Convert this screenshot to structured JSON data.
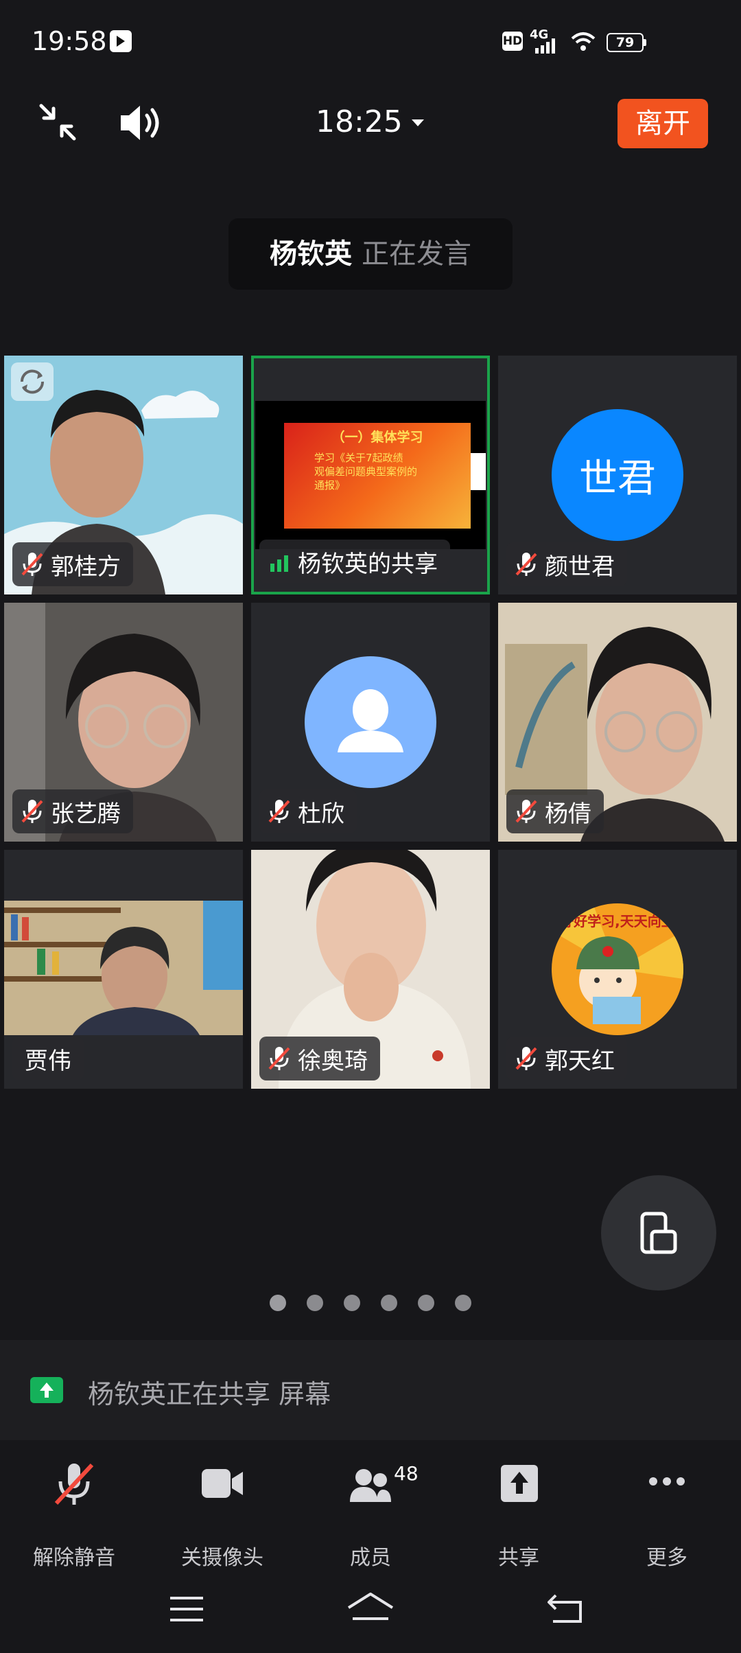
{
  "status_bar": {
    "time": "19:58",
    "hd": "HD",
    "network": "4G",
    "battery": "79"
  },
  "top_bar": {
    "meeting_time": "18:25",
    "leave_label": "离开"
  },
  "speaking_banner": {
    "name": "杨钦英",
    "text": "正在发言"
  },
  "tiles": [
    {
      "name": "郭桂方",
      "kind": "video",
      "muted": true
    },
    {
      "name": "杨钦英的共享",
      "kind": "screen-share",
      "muted": false,
      "active_speaker": true
    },
    {
      "name": "颜世君",
      "kind": "avatar",
      "avatar_text": "世君",
      "avatar_color": "#0a87ff",
      "muted": true
    },
    {
      "name": "张艺腾",
      "kind": "video",
      "muted": true
    },
    {
      "name": "杜欣",
      "kind": "avatar-default",
      "avatar_color": "#7fb5ff",
      "muted": true
    },
    {
      "name": "杨倩",
      "kind": "video",
      "muted": true
    },
    {
      "name": "贾伟",
      "kind": "video",
      "muted": false
    },
    {
      "name": "徐奥琦",
      "kind": "video",
      "muted": true
    },
    {
      "name": "郭天红",
      "kind": "avatar-image",
      "muted": true
    }
  ],
  "shared_slide": {
    "heading": "（一）集体学习",
    "line1": "学习《关于7起政绩",
    "line2": "观偏差问题典型案例的",
    "line3": "通报》"
  },
  "avatar_image_text": "好好学习,天天向上",
  "pager": {
    "total": 6,
    "current": 1
  },
  "share_bar": {
    "text": "杨钦英正在共享  屏幕"
  },
  "toolbar": {
    "unmute": "解除静音",
    "camera": "关摄像头",
    "members": "成员",
    "member_count": "48",
    "share": "共享",
    "more": "更多"
  },
  "colors": {
    "accent_leave": "#f2531f",
    "active_border": "#1aa34a",
    "background": "#17171a",
    "muted_red": "#f24a3d"
  }
}
